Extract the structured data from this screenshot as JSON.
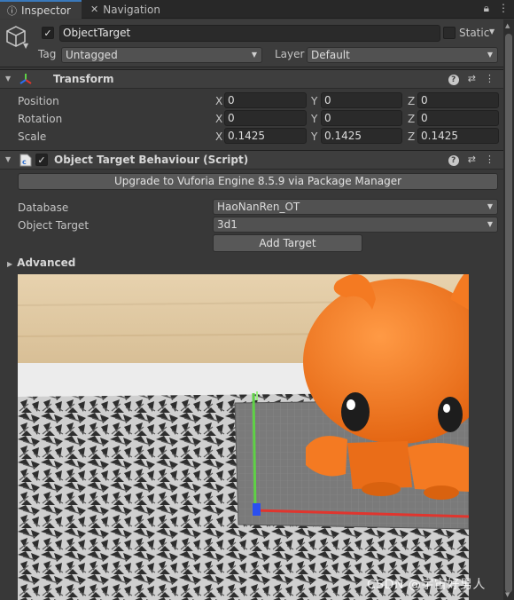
{
  "tabs": {
    "inspector": "Inspector",
    "navigation": "Navigation"
  },
  "object": {
    "name": "ObjectTarget",
    "static_label": "Static",
    "tag_label": "Tag",
    "tag_value": "Untagged",
    "layer_label": "Layer",
    "layer_value": "Default"
  },
  "transform": {
    "title": "Transform",
    "rows": {
      "position": {
        "label": "Position",
        "x": "0",
        "y": "0",
        "z": "0"
      },
      "rotation": {
        "label": "Rotation",
        "x": "0",
        "y": "0",
        "z": "0"
      },
      "scale": {
        "label": "Scale",
        "x": "0.1425",
        "y": "0.1425",
        "z": "0.1425"
      }
    },
    "axis": {
      "x": "X",
      "y": "Y",
      "z": "Z"
    }
  },
  "behaviour": {
    "title": "Object Target Behaviour (Script)",
    "upgrade_button": "Upgrade to Vuforia Engine 8.5.9 via Package Manager",
    "database_label": "Database",
    "database_value": "HaoNanRen_OT",
    "object_target_label": "Object Target",
    "object_target_value": "3d1",
    "add_target_button": "Add Target",
    "advanced_label": "Advanced"
  },
  "watermark": "CSDN @宇宙好男人",
  "colors": {
    "accent_tab": "#3a79bb",
    "panel": "#383838",
    "axis_x": "#e0352e",
    "axis_y": "#5fd146",
    "axis_z": "#2a4ff0",
    "toy_orange": "#f47a22"
  }
}
